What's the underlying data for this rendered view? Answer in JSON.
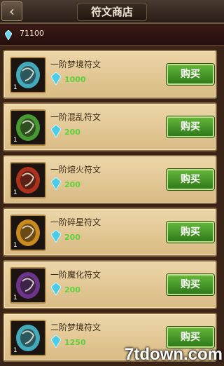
{
  "header": {
    "title": "符文商店",
    "back_icon": "back-arrow-icon"
  },
  "currency": {
    "icon": "blue-crystal-icon",
    "amount": "71100"
  },
  "items": [
    {
      "name": "一阶梦境符文",
      "price": "1000",
      "count": "1",
      "buy_label": "购买",
      "icon": "dream-rune-icon",
      "color": "#49c4d8"
    },
    {
      "name": "一阶混乱符文",
      "price": "200",
      "count": "1",
      "buy_label": "购买",
      "icon": "chaos-rune-icon",
      "color": "#4fb23a"
    },
    {
      "name": "一阶熔火符文",
      "price": "200",
      "count": "1",
      "buy_label": "购买",
      "icon": "molten-rune-icon",
      "color": "#c8361e"
    },
    {
      "name": "一阶碎星符文",
      "price": "200",
      "count": "1",
      "buy_label": "购买",
      "icon": "shatter-star-rune-icon",
      "color": "#e7a020"
    },
    {
      "name": "一阶魔化符文",
      "price": "200",
      "count": "1",
      "buy_label": "购买",
      "icon": "demonic-rune-icon",
      "color": "#7a3aa0"
    },
    {
      "name": "二阶梦境符文",
      "price": "1250",
      "count": "1",
      "buy_label": "购买",
      "icon": "dream-rune-icon",
      "color": "#49c4d8"
    }
  ],
  "watermark": "7tdown.com"
}
